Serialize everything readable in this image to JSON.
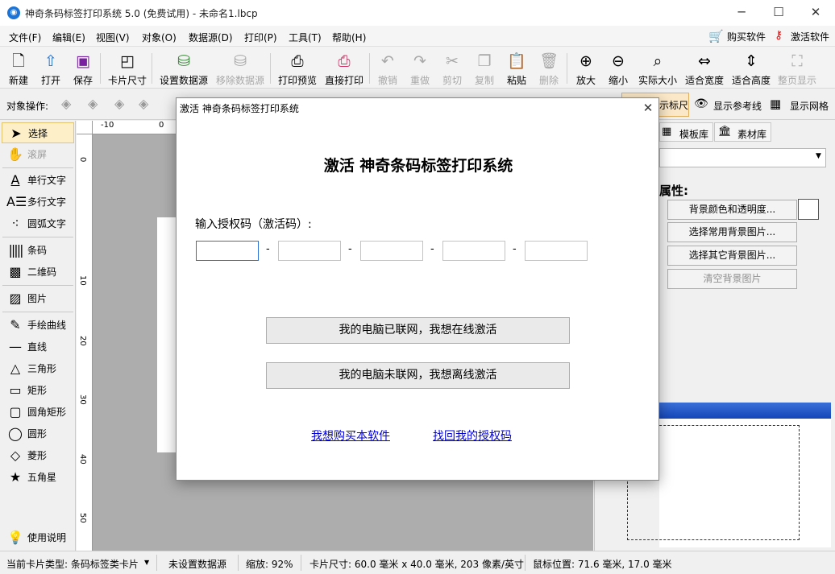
{
  "window": {
    "title": "神奇条码标签打印系统 5.0 (免费试用) - 未命名1.lbcp",
    "app_icon": "app-logo-icon",
    "minimize": "─",
    "maximize": "☐",
    "close": "✕"
  },
  "menu": {
    "items": [
      "文件(F)",
      "编辑(E)",
      "视图(V)",
      "对象(O)",
      "数据源(D)",
      "打印(P)",
      "工具(T)",
      "帮助(H)"
    ],
    "buy": "购买软件",
    "activate": "激活软件"
  },
  "toolbar": {
    "items": [
      {
        "label": "新建",
        "icon": "new-file-icon"
      },
      {
        "label": "打开",
        "icon": "open-icon"
      },
      {
        "label": "保存",
        "icon": "save-icon"
      },
      {
        "label": "卡片尺寸",
        "icon": "card-size-icon"
      },
      {
        "label": "设置数据源",
        "icon": "database-icon"
      },
      {
        "label": "移除数据源",
        "icon": "database-remove-icon"
      },
      {
        "label": "打印预览",
        "icon": "print-preview-icon"
      },
      {
        "label": "直接打印",
        "icon": "printer-icon"
      },
      {
        "label": "撤销",
        "icon": "undo-icon"
      },
      {
        "label": "重做",
        "icon": "redo-icon"
      },
      {
        "label": "剪切",
        "icon": "cut-icon"
      },
      {
        "label": "复制",
        "icon": "copy-icon"
      },
      {
        "label": "粘贴",
        "icon": "paste-icon"
      },
      {
        "label": "删除",
        "icon": "delete-icon"
      },
      {
        "label": "放大",
        "icon": "zoom-in-icon"
      },
      {
        "label": "缩小",
        "icon": "zoom-out-icon"
      },
      {
        "label": "实际大小",
        "icon": "actual-size-icon"
      },
      {
        "label": "适合宽度",
        "icon": "fit-width-icon"
      },
      {
        "label": "适合高度",
        "icon": "fit-height-icon"
      },
      {
        "label": "整页显示",
        "icon": "fit-page-icon"
      }
    ]
  },
  "object_bar": {
    "label": "对象操作:",
    "show_ruler": "示标尺",
    "show_guides": "显示参考线",
    "show_grid": "显示网格"
  },
  "tools": {
    "items": [
      "选择",
      "滚屏",
      "单行文字",
      "多行文字",
      "圆弧文字",
      "条码",
      "二维码",
      "图片",
      "手绘曲线",
      "直线",
      "三角形",
      "矩形",
      "圆角矩形",
      "圆形",
      "菱形",
      "五角星"
    ],
    "help": "使用说明"
  },
  "rulers": {
    "h": [
      "-10",
      "0"
    ],
    "v": [
      "0",
      "10",
      "20",
      "30",
      "40",
      "50"
    ]
  },
  "right_panel": {
    "tab_templates": "模板库",
    "tab_assets": "素材库",
    "props_title": "属性:",
    "btn_bg_color": "背景颜色和透明度...",
    "btn_bg_common": "选择常用背景图片...",
    "btn_bg_other": "选择其它背景图片...",
    "btn_bg_clear": "清空背景图片"
  },
  "status": {
    "card_type": "当前卡片类型: 条码标签类卡片",
    "datasource": "未设置数据源",
    "zoom": "缩放: 92%",
    "card_size": "卡片尺寸: 60.0 毫米 x 40.0 毫米, 203 像素/英寸",
    "mouse_pos": "鼠标位置: 71.6 毫米, 17.0 毫米"
  },
  "dialog": {
    "title": "激活 神奇条码标签打印系统",
    "close": "✕",
    "heading": "激活 神奇条码标签打印系统",
    "prompt": "输入授权码（激活码）:",
    "code_fields": [
      "",
      "",
      "",
      "",
      ""
    ],
    "btn_online": "我的电脑已联网，我想在线激活",
    "btn_offline": "我的电脑未联网，我想离线激活",
    "link_buy": "我想购买本软件",
    "link_recover": "找回我的授权码"
  }
}
